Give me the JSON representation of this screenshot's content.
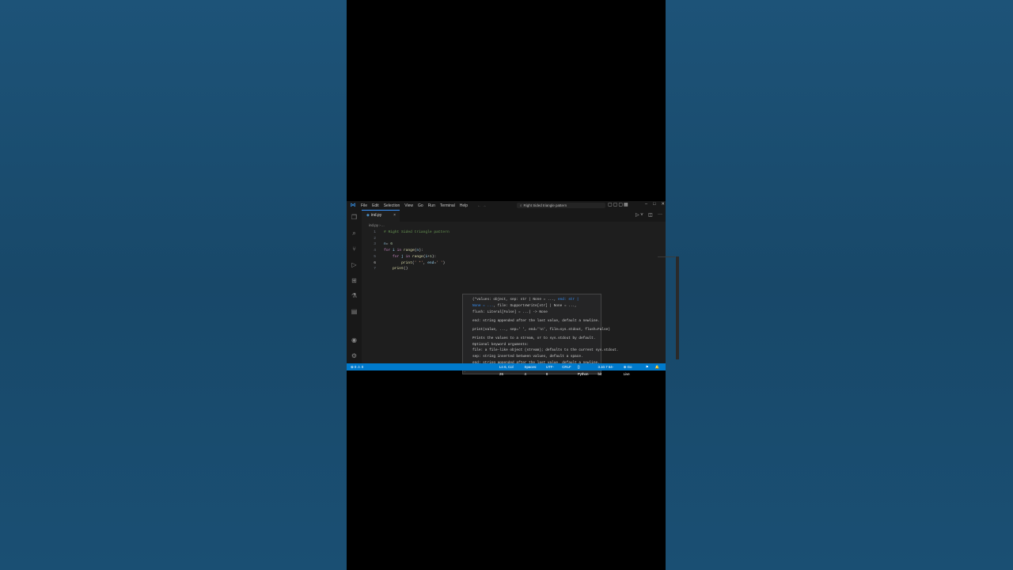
{
  "menu": [
    "File",
    "Edit",
    "Selection",
    "View",
    "Go",
    "Run",
    "Terminal",
    "Help"
  ],
  "title_search": "Right Sided triangle pattern",
  "tab": {
    "name": "ind.py",
    "close": "×"
  },
  "breadcrumb": "ind.py › ...",
  "code_lines": [
    {
      "n": "1",
      "text": "# Right Sided triangle pattern"
    },
    {
      "n": "2",
      "text": ""
    },
    {
      "n": "3",
      "text": "n= 6"
    },
    {
      "n": "4",
      "text": "for i in range(n):"
    },
    {
      "n": "5",
      "text": "    for j in range(i+1):"
    },
    {
      "n": "6",
      "text": "        print(' *', end=' ')"
    },
    {
      "n": "7",
      "text": "    print()"
    }
  ],
  "hover": {
    "sig1": "(*values: object, sep: str | None = ..., ",
    "sig1_hl": "end: str |",
    "sig2_hl": "None = ...",
    "sig2": ", file: SupportsWrite[str] | None = ...,",
    "sig3": "flush: Literal[False] = ...) -> None",
    "end_doc": "end:  string appended after the last value, default a newline.",
    "usage": "print(value, ..., sep=' ', end='\\n', file=sys.stdout, flush=False)",
    "doc1": "Prints the values to a stream, or to sys.stdout by default.",
    "doc2": "Optional keyword arguments:",
    "doc3": "file: a file-like object (stream); defaults to the current sys.stdout.",
    "doc4": "sep: string inserted between values, default a space.",
    "doc5": "end: string appended after the last value, default a newline.",
    "doc6": "flush: whether to forcibly flush the stream.",
    "counter": "1/2"
  },
  "status": {
    "left": "⊗ 0 ⚠ 0",
    "items": [
      "Ln 6, Col 26",
      "Spaces: 4",
      "UTF-8",
      "CRLF",
      "{} Python",
      "3.10.7 64-bit",
      "⊕ Go Live"
    ]
  }
}
